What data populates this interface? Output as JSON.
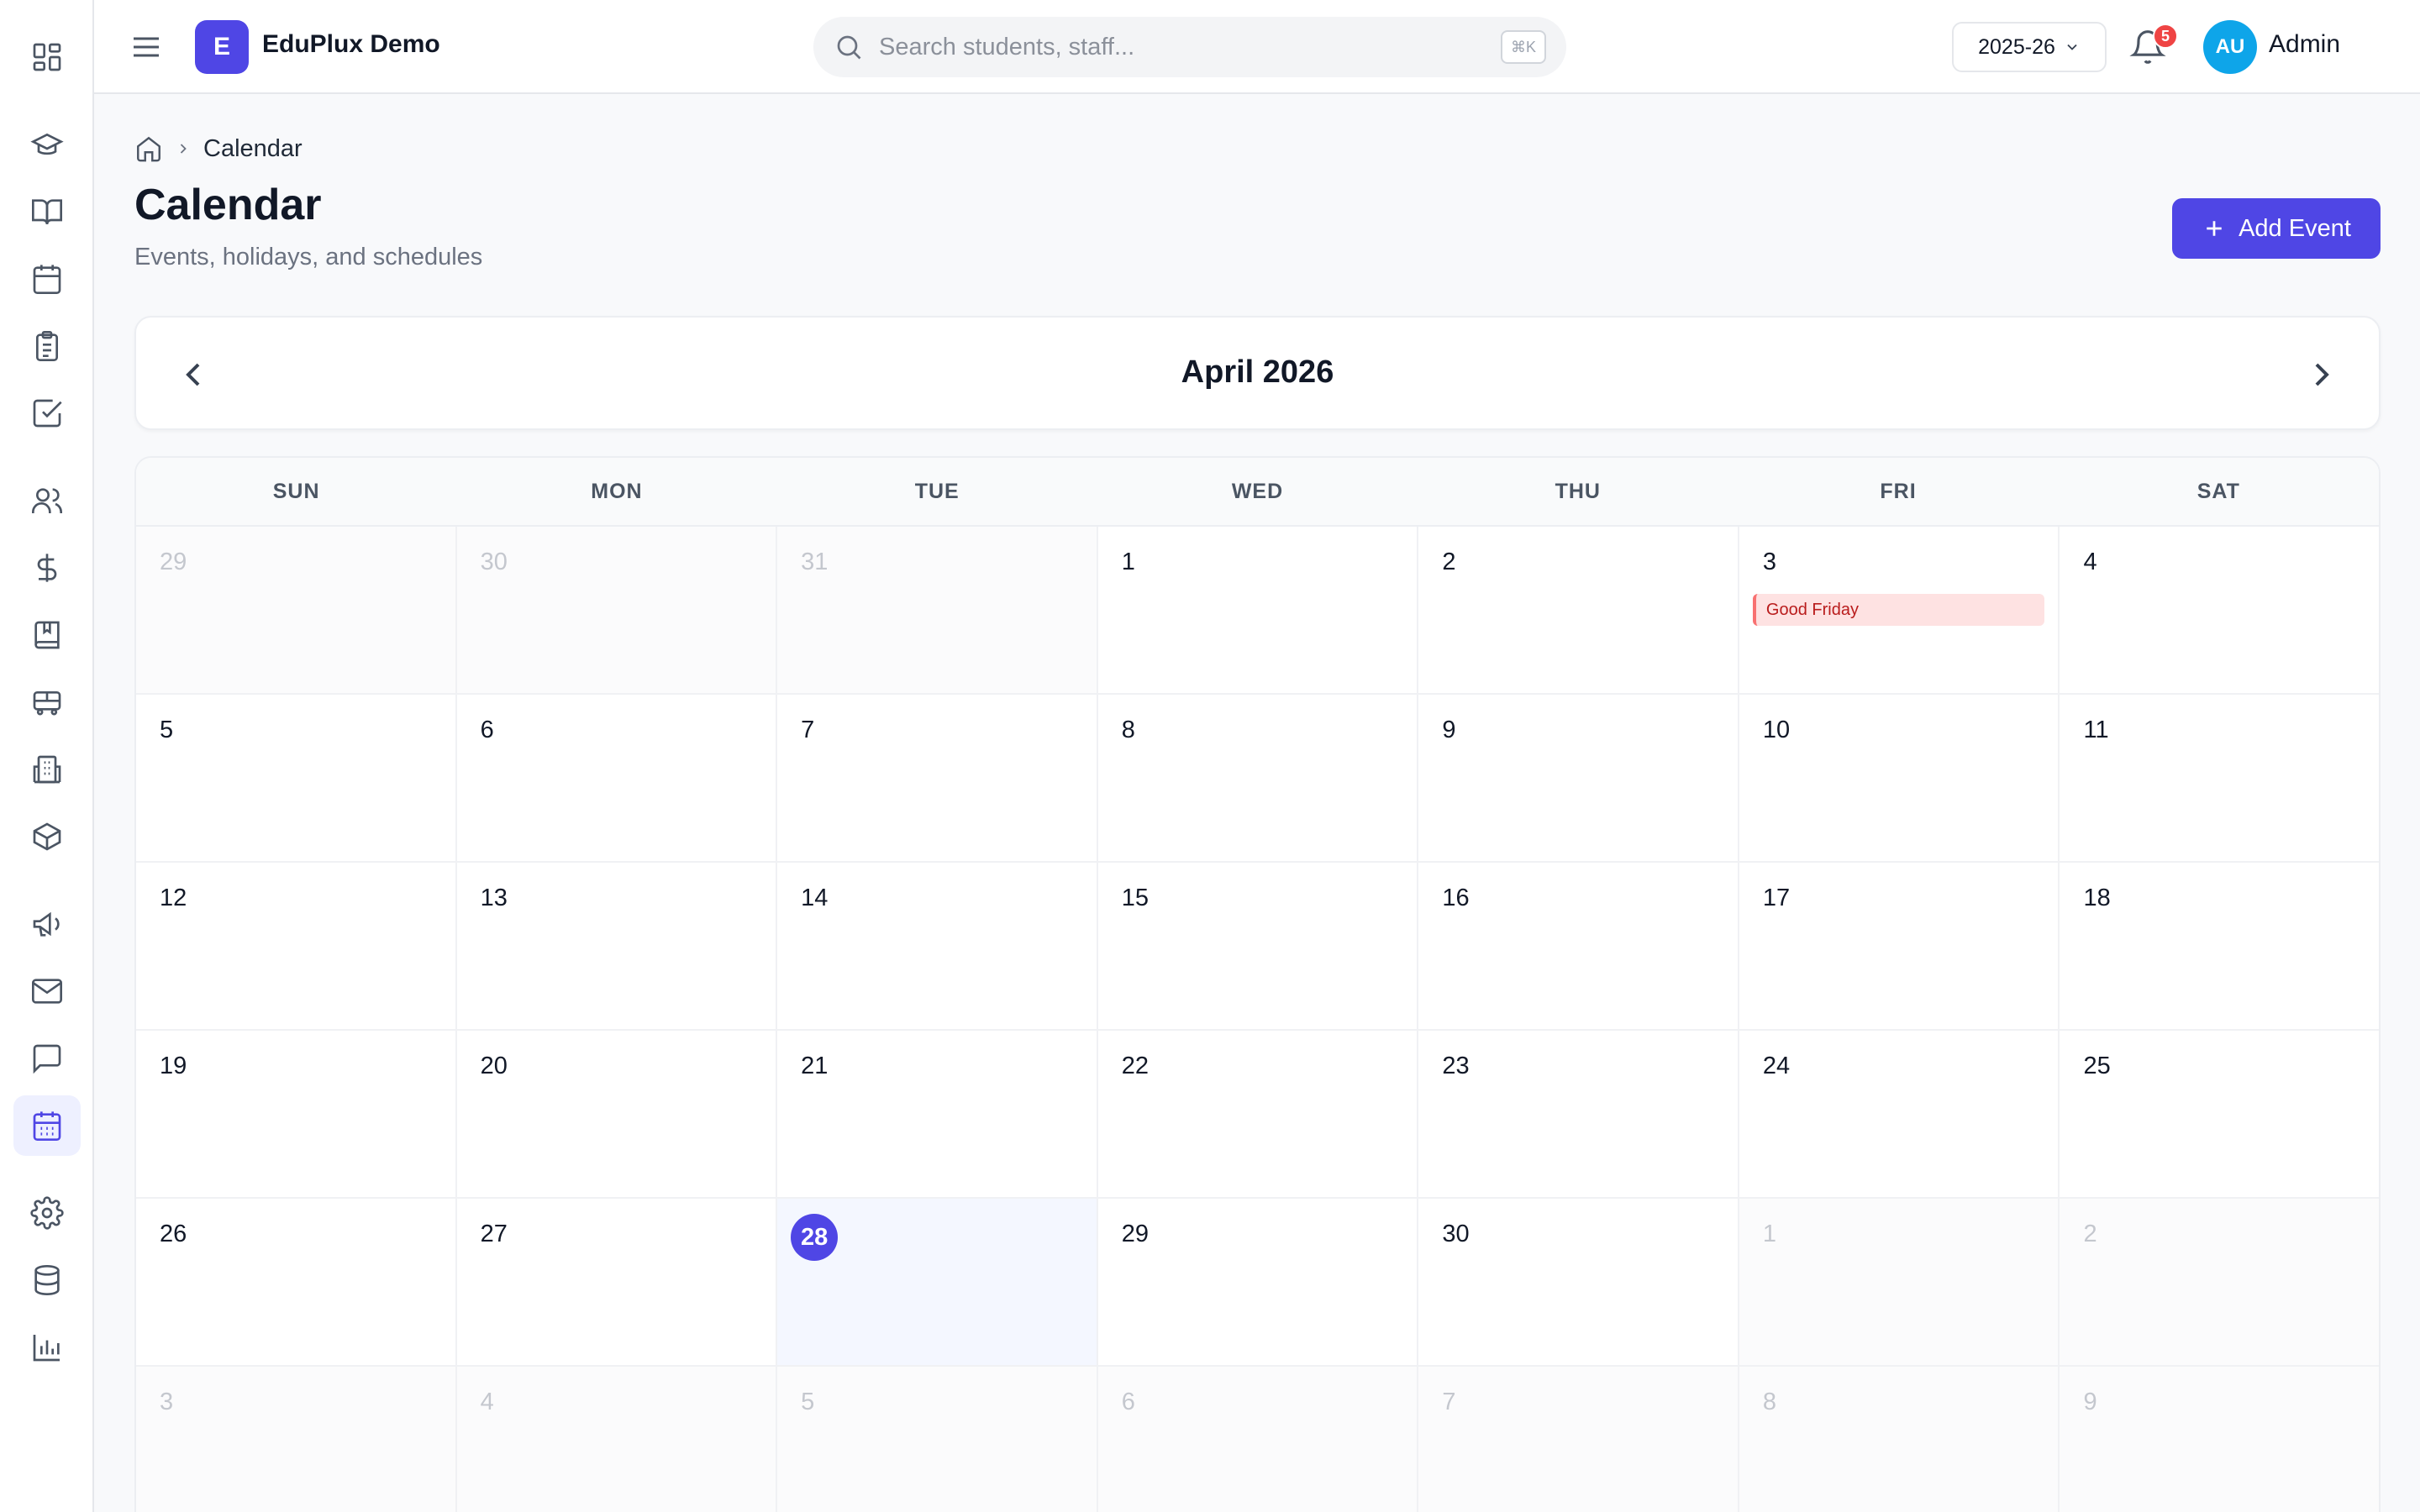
{
  "app": {
    "logo_letter": "E",
    "name": "EduPlux Demo"
  },
  "search": {
    "placeholder": "Search students, staff...",
    "shortcut": "⌘K"
  },
  "header": {
    "academic_year": "2025-26",
    "notification_count": "5",
    "user_initials": "AU",
    "user_name": "Admin"
  },
  "sidebar": {
    "items": [
      {
        "icon": "dashboard-icon"
      },
      {
        "icon": "graduation-cap-icon"
      },
      {
        "icon": "book-icon"
      },
      {
        "icon": "calendar-icon"
      },
      {
        "icon": "clipboard-icon"
      },
      {
        "icon": "check-square-icon"
      },
      {
        "icon": "users-icon"
      },
      {
        "icon": "dollar-icon"
      },
      {
        "icon": "library-book-icon"
      },
      {
        "icon": "bus-icon"
      },
      {
        "icon": "building-icon"
      },
      {
        "icon": "box-icon"
      },
      {
        "icon": "megaphone-icon"
      },
      {
        "icon": "mail-icon"
      },
      {
        "icon": "chat-icon"
      },
      {
        "icon": "calendar-days-icon",
        "active": true
      },
      {
        "icon": "settings-icon"
      },
      {
        "icon": "database-icon"
      },
      {
        "icon": "bar-chart-icon"
      }
    ]
  },
  "page": {
    "breadcrumb_current": "Calendar",
    "title": "Calendar",
    "subtitle": "Events, holidays, and schedules",
    "add_button": "Add Event"
  },
  "calendar": {
    "month_label": "April 2026",
    "weekdays": [
      "SUN",
      "MON",
      "TUE",
      "WED",
      "THU",
      "FRI",
      "SAT"
    ],
    "weeks": [
      [
        {
          "n": "29",
          "other": true
        },
        {
          "n": "30",
          "other": true
        },
        {
          "n": "31",
          "other": true
        },
        {
          "n": "1"
        },
        {
          "n": "2"
        },
        {
          "n": "3",
          "event": "Good Friday"
        },
        {
          "n": "4"
        }
      ],
      [
        {
          "n": "5"
        },
        {
          "n": "6"
        },
        {
          "n": "7"
        },
        {
          "n": "8"
        },
        {
          "n": "9"
        },
        {
          "n": "10"
        },
        {
          "n": "11"
        }
      ],
      [
        {
          "n": "12"
        },
        {
          "n": "13"
        },
        {
          "n": "14"
        },
        {
          "n": "15"
        },
        {
          "n": "16"
        },
        {
          "n": "17"
        },
        {
          "n": "18"
        }
      ],
      [
        {
          "n": "19"
        },
        {
          "n": "20"
        },
        {
          "n": "21"
        },
        {
          "n": "22"
        },
        {
          "n": "23"
        },
        {
          "n": "24"
        },
        {
          "n": "25"
        }
      ],
      [
        {
          "n": "26"
        },
        {
          "n": "27"
        },
        {
          "n": "28",
          "today": true
        },
        {
          "n": "29"
        },
        {
          "n": "30"
        },
        {
          "n": "1",
          "other": true
        },
        {
          "n": "2",
          "other": true
        }
      ],
      [
        {
          "n": "3",
          "other": true
        },
        {
          "n": "4",
          "other": true
        },
        {
          "n": "5",
          "other": true
        },
        {
          "n": "6",
          "other": true
        },
        {
          "n": "7",
          "other": true
        },
        {
          "n": "8",
          "other": true
        },
        {
          "n": "9",
          "other": true
        }
      ]
    ]
  },
  "colors": {
    "accent": "#4f46e5",
    "holiday_bg": "#fee2e2",
    "holiday_text": "#b91c1c",
    "avatar": "#0ea5e9",
    "badge": "#ef4444"
  }
}
